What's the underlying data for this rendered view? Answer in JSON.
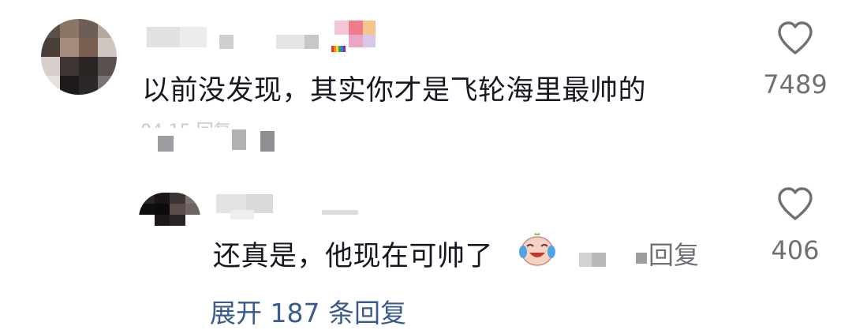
{
  "comment": {
    "text": "以前没发现，其实你才是飞轮海里最帅的",
    "likes": "7489",
    "meta_faded": "04-15 回复"
  },
  "reply": {
    "text": "还真是，他现在可帅了",
    "reply_label": "回复",
    "likes": "406",
    "emoji": "laughing-crying-face"
  },
  "expand_replies": "展开 187 条回复",
  "icons": {
    "like": "heart-outline-icon"
  },
  "colors": {
    "text": "#161823",
    "muted": "#6f7075",
    "link": "#3a5b8b"
  }
}
